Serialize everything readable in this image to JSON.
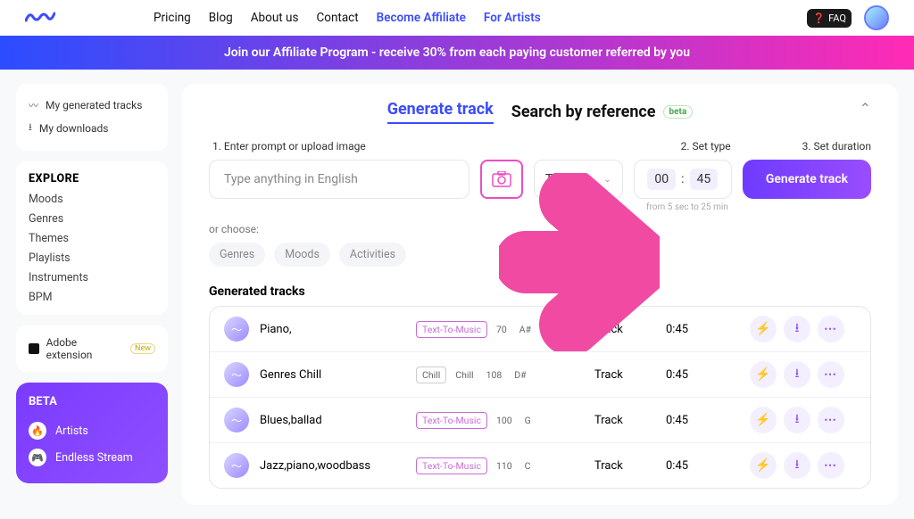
{
  "topnav": {
    "links": [
      "Pricing",
      "Blog",
      "About us",
      "Contact"
    ],
    "accent_a": "Become Affiliate",
    "accent_b": "For Artists",
    "faq": "FAQ"
  },
  "banner": "Join our Affiliate Program - receive 30% from each paying customer referred by you",
  "side": {
    "generated": "My generated tracks",
    "downloads": "My downloads",
    "explore_title": "EXPLORE",
    "explore": [
      "Moods",
      "Genres",
      "Themes",
      "Playlists",
      "Instruments",
      "BPM"
    ],
    "adobe": "Adobe extension",
    "new": "New",
    "beta_title": "BETA",
    "beta_items": [
      "Artists",
      "Endless Stream"
    ]
  },
  "main": {
    "tab_a": "Generate track",
    "tab_b": "Search by reference",
    "beta": "beta",
    "step1": "1. Enter prompt or upload image",
    "step2": "2. Set type",
    "step3": "3. Set duration",
    "prompt_placeholder": "Type anything in English",
    "type_value": "Track",
    "dur_min": "00",
    "dur_sep": ":",
    "dur_sec": "45",
    "dur_hint": "from 5 sec to 25 min",
    "gen_btn": "Generate track",
    "or_choose": "or choose:",
    "chips": [
      "Genres",
      "Moods",
      "Activities"
    ],
    "gt_title": "Generated tracks",
    "rows": [
      {
        "title": "Piano,",
        "tags": [
          "Text-To-Music",
          "70",
          "A#"
        ],
        "type": "Track",
        "dur": "0:45"
      },
      {
        "title": "Genres Chill",
        "tags": [
          "Chill",
          "Chill",
          "108",
          "D#"
        ],
        "type": "Track",
        "dur": "0:45",
        "grey": true
      },
      {
        "title": "Blues,ballad",
        "tags": [
          "Text-To-Music",
          "100",
          "G"
        ],
        "type": "Track",
        "dur": "0:45"
      },
      {
        "title": "Jazz,piano,woodbass",
        "tags": [
          "Text-To-Music",
          "110",
          "C"
        ],
        "type": "Track",
        "dur": "0:45"
      }
    ]
  }
}
